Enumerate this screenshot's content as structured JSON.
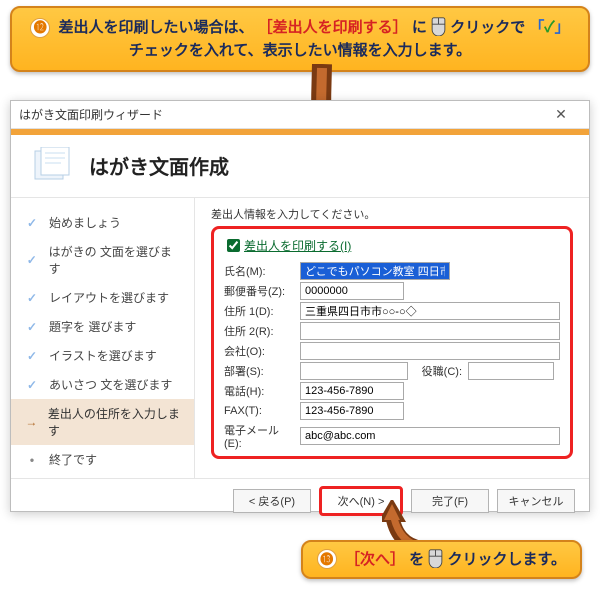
{
  "callout_top": {
    "badge": "⓬",
    "t1": "差出人を印刷したい場合は、",
    "t2": "［差出人を印刷する］",
    "t3": "に",
    "mouse": "🖱",
    "t4": "クリックで",
    "t5": "「",
    "t6": "✓",
    "t7": "」",
    "t8": "チェックを入れて、表示したい情報を入力します。"
  },
  "callout_bottom": {
    "badge": "⓭",
    "t1": "［次へ］",
    "t2": "を",
    "t3": "クリックします。"
  },
  "dialog": {
    "title": "はがき文面印刷ウィザード",
    "heading": "はがき文面作成",
    "sidebar": {
      "items": [
        {
          "mark": "✓",
          "label": "始めましょう"
        },
        {
          "mark": "✓",
          "label": "はがきの 文面を選びます"
        },
        {
          "mark": "✓",
          "label": "レイアウトを選びます"
        },
        {
          "mark": "✓",
          "label": "題字を 選びます"
        },
        {
          "mark": "✓",
          "label": "イラストを選びます"
        },
        {
          "mark": "✓",
          "label": "あいさつ 文を選びます"
        },
        {
          "mark": "→",
          "label": "差出人の住所を入力します",
          "active": true
        },
        {
          "mark": "•",
          "label": "終了です"
        }
      ]
    },
    "main": {
      "prompt": "差出人情報を入力してください。",
      "checkbox_label": "差出人を印刷する(I)",
      "fields": {
        "name_label": "氏名(M):",
        "name_val": "どこでもパソコン教室 四日市",
        "postal_label": "郵便番号(Z):",
        "postal_val": "0000000",
        "addr1_label": "住所 1(D):",
        "addr1_val": "三重県四日市市○○-○◇",
        "addr2_label": "住所 2(R):",
        "addr2_val": "",
        "company_label": "会社(O):",
        "company_val": "",
        "dept_label": "部署(S):",
        "dept_val": "",
        "role_label": "役職(C):",
        "role_val": "",
        "tel_label": "電話(H):",
        "tel_val": "123-456-7890",
        "fax_label": "FAX(T):",
        "fax_val": "123-456-7890",
        "email_label": "電子メール(E):",
        "email_val": "abc@abc.com"
      }
    },
    "footer": {
      "back": "< 戻る(P)",
      "next": "次へ(N) >",
      "finish": "完了(F)",
      "cancel": "キャンセル"
    }
  }
}
